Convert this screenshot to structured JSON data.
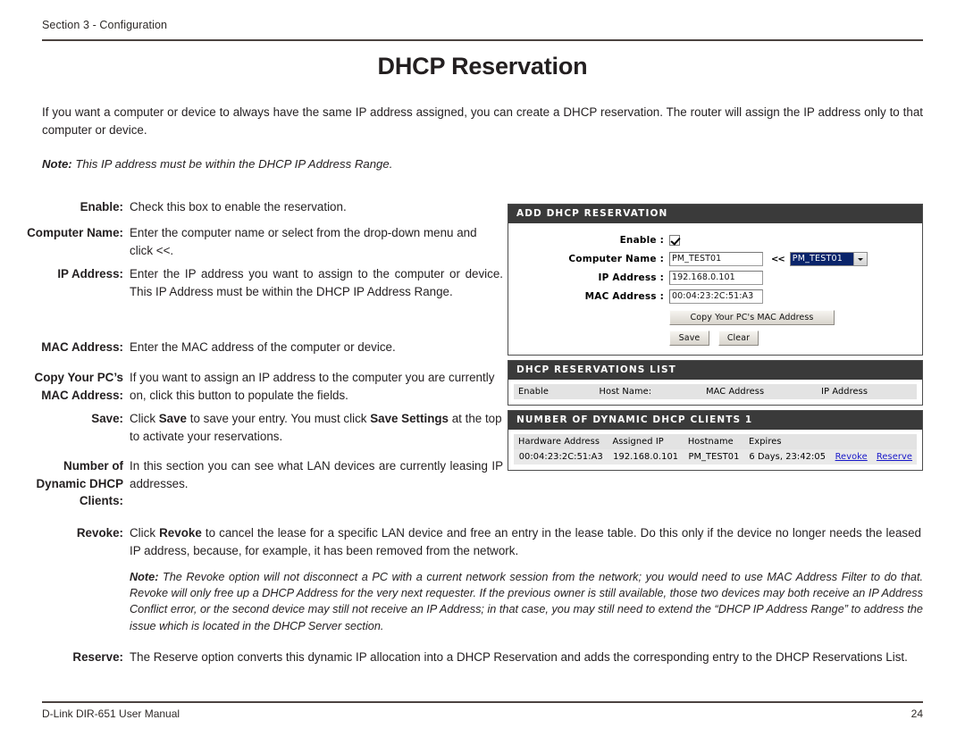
{
  "header": {
    "section": "Section 3 - Configuration",
    "title": "DHCP Reservation"
  },
  "intro": {
    "paragraph": "If you want a computer or device to always have the same IP address assigned, you can create a DHCP reservation. The router will assign the IP address only to that computer or device.",
    "note_label": "Note:",
    "note_text": "This IP address must be within the DHCP IP Address Range."
  },
  "definitions": [
    {
      "label": "Enable:",
      "text": "Check this box to enable the reservation."
    },
    {
      "label": "Computer Name:",
      "text": "Enter the computer name or select from the drop-down menu and click <<."
    },
    {
      "label": "IP Address:",
      "text": "Enter the IP address you want to assign to the computer or device. This IP Address must be within the DHCP IP Address Range."
    },
    {
      "label": "MAC Address:",
      "text": "Enter the MAC address of the computer or device."
    },
    {
      "label": "Copy Your PC’s MAC Address:",
      "text": "If you want to assign an IP address to the computer you are currently on, click this button to populate the fields."
    },
    {
      "label": "Save:",
      "text_part1": "Click ",
      "bold1": "Save",
      "text_part2": " to save your entry. You must click ",
      "bold2": "Save Settings",
      "text_part3": " at the top to activate your reservations."
    },
    {
      "label": "Number of Dynamic DHCP Clients:",
      "text": "In this section you can see what LAN devices are currently leasing IP addresses."
    },
    {
      "label": "Revoke:",
      "text_part1": "Click ",
      "bold1": "Revoke",
      "text_part2": " to cancel the lease for a specific LAN device and free an entry in the lease table. Do this only if the device no longer needs the leased IP address, because, for example, it has been removed from the network."
    },
    {
      "label": "Reserve:",
      "text": "The Reserve option converts this dynamic IP allocation into a DHCP Reservation and adds the corresponding entry to the DHCP Reservations List."
    }
  ],
  "revoke_note": {
    "label": "Note:",
    "text": "The Revoke option will not disconnect a PC with a current network session from the network; you would need to use MAC Address Filter to do that. Revoke will only free up a DHCP Address for the very next requester. If the previous owner is still available, those two devices may both receive an IP Address Conflict error, or the second device may still not receive an IP Address; in that case, you may still need to extend the “DHCP IP Address Range” to address the issue which is located in the DHCP Server section."
  },
  "router_ui": {
    "add_panel": {
      "title": "ADD DHCP RESERVATION",
      "fields": {
        "enable_label": "Enable :",
        "enable_checked": true,
        "computer_name_label": "Computer Name :",
        "computer_name_value": "PM_TEST01",
        "arrows": "<<",
        "dropdown_selected": "PM_TEST01",
        "ip_label": "IP Address :",
        "ip_value": "192.168.0.101",
        "mac_label": "MAC Address :",
        "mac_value": "00:04:23:2C:51:A3"
      },
      "buttons": {
        "copy_mac": "Copy Your PC's MAC Address",
        "save": "Save",
        "clear": "Clear"
      }
    },
    "reservations_panel": {
      "title": "DHCP RESERVATIONS LIST",
      "columns": [
        "Enable",
        "Host Name:",
        "MAC Address",
        "IP Address",
        ""
      ],
      "rows": []
    },
    "dynamic_panel": {
      "title": "NUMBER OF DYNAMIC DHCP CLIENTS 1",
      "columns": [
        "Hardware Address",
        "Assigned IP",
        "Hostname",
        "Expires",
        "",
        ""
      ],
      "rows": [
        {
          "hardware_address": "00:04:23:2C:51:A3",
          "assigned_ip": "192.168.0.101",
          "hostname": "PM_TEST01",
          "expires": "6 Days, 23:42:05",
          "revoke": "Revoke",
          "reserve": "Reserve"
        }
      ]
    }
  },
  "footer": {
    "left": "D-Link DIR-651 User Manual",
    "page_number": "24"
  },
  "colors": {
    "rule": "#4b4340",
    "ui_header_bar": "#3a3a3a",
    "link": "#1717c9",
    "dropdown_selected_bg": "#0a246a"
  }
}
